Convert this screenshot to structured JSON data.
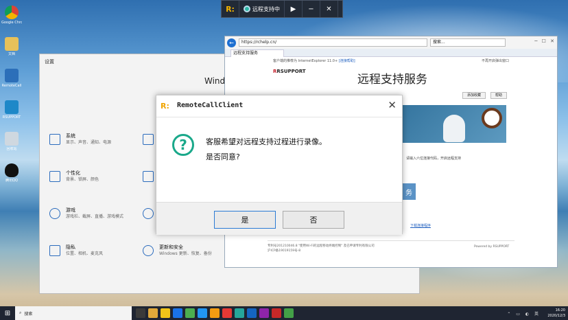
{
  "remote_bar": {
    "status_text": "远程支持中",
    "buttons": [
      "▶",
      "−",
      "✕"
    ]
  },
  "desktop_icons": [
    {
      "label": "Google Chrome",
      "color": "#e8eaed"
    },
    {
      "label": "文档",
      "color": "#e7c15a"
    },
    {
      "label": "RemoteCall",
      "color": "#2c6fb9"
    },
    {
      "label": "RSUPPORT",
      "color": "#2c6fb9"
    },
    {
      "label": "回收站",
      "color": "#cfd8e0"
    },
    {
      "label": "腾讯QQ",
      "color": "#111111"
    }
  ],
  "settings": {
    "window_title": "设置",
    "heading": "Windo",
    "items": [
      {
        "name": "系统",
        "desc": "显示、声音、通知、电源"
      },
      {
        "name": "个性化",
        "desc": "背景、锁屏、颜色"
      },
      {
        "name": "游戏",
        "desc": "游戏栏、截屏、直播、游戏模式"
      },
      {
        "name": "隐私",
        "desc": "位置、相机、麦克风"
      },
      {
        "name": "更新和安全",
        "desc": "Windows 更新、恢复、备份"
      }
    ]
  },
  "browser": {
    "url": "https://rchelp.cn/",
    "search_placeholder": "搜索...",
    "tab_title": "远程支持服务",
    "infobar_text": "客户端的推荐为 InternetExplorer 11.0+",
    "infobar_link": "[连接帮助]",
    "popup_text": "不再开启弹出窗口",
    "brand": "RSUPPORT",
    "page_title": "远程支持服务",
    "btn_add": "添加收藏",
    "btn_help": "帮助",
    "banner_note": "请输入六位连接代码，开启远程支持",
    "start_button": "务",
    "download_link": "下载连接程序",
    "footer_line1": "专利号201210046.8 \"使用Wi-Fi的远程移动终端控制\" 及已申请专利有限公司",
    "footer_line2": "沪ICP备19019159号-8",
    "powered_by": "Powered by RSUPPORT"
  },
  "dialog": {
    "title": "RemoteCallClient",
    "message_line1": "客服希望对远程支持过程进行录像。",
    "message_line2": "是否同意?",
    "yes_label": "是",
    "no_label": "否"
  },
  "taskbar": {
    "search_text": "搜索",
    "time": "16:20",
    "date": "2020/12/3",
    "app_colors": [
      "#3a3a3a",
      "#e1a93a",
      "#f0c419",
      "#1a73e8",
      "#4caf50",
      "#2196f3",
      "#f39c12",
      "#e53935",
      "#26a69a",
      "#1565c0",
      "#8e24aa",
      "#c62828",
      "#43a047"
    ]
  }
}
